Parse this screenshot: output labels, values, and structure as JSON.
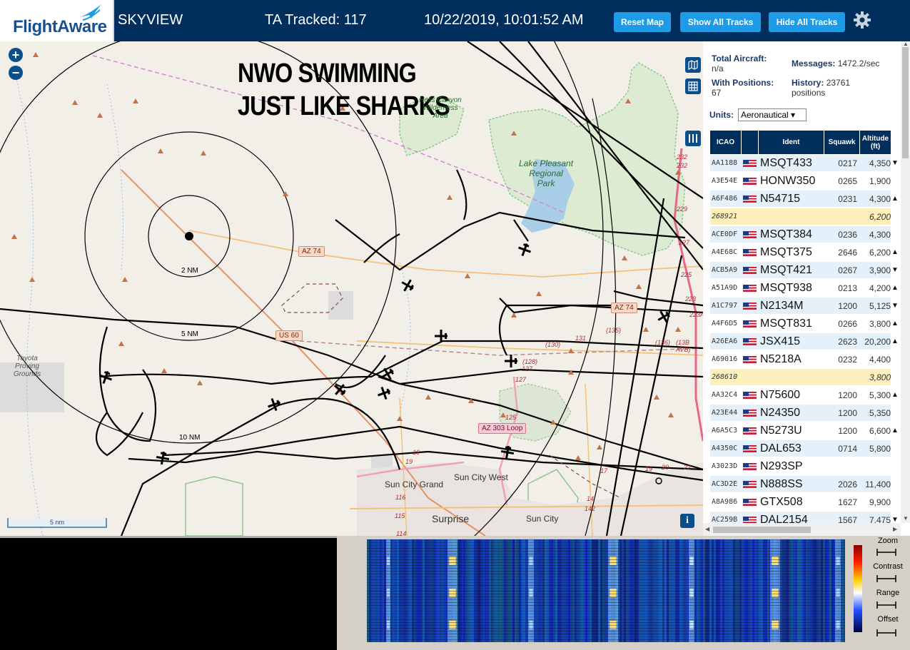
{
  "header": {
    "logo_text": "FlightAware",
    "app_name": "SKYVIEW",
    "tracked": "TA Tracked: 117",
    "datetime": "10/22/2019, 10:01:52 AM",
    "buttons": {
      "reset_map": "Reset Map",
      "show_all": "Show All Tracks",
      "hide_all": "Hide All Tracks"
    },
    "colors": {
      "bar": "#002f5d",
      "button": "#1e9be6"
    }
  },
  "map": {
    "zoom_in": "+",
    "zoom_out": "−",
    "overlay_line1": "NWO SWIMMING",
    "overlay_line2": "JUST LIKE SHARKS",
    "rings": {
      "r2": "2 NM",
      "r5": "5 NM",
      "r10": "10 NM"
    },
    "places": {
      "hells_canyon": "Hells Canyon\nWilderness\nArea",
      "lake_pleasant": "Lake Pleasant\nRegional\nPark",
      "toyota": "Toyota\nProving\nGrounds",
      "sun_city_grand": "Sun City Grand",
      "sun_city_west": "Sun City West",
      "surprise": "Surprise",
      "sun_city": "Sun City"
    },
    "shields": {
      "az74a": "AZ 74",
      "az74b": "AZ 74",
      "us60": "US 60",
      "loop303": "AZ 303 Loop"
    },
    "route_numbers": [
      "232",
      "232",
      "229",
      "227",
      "225",
      "223",
      "223A",
      "(136)",
      "(13B AVB)",
      "(135)",
      "131",
      "(130)",
      "(128)",
      "127",
      "127",
      "125",
      "19",
      "19",
      "20",
      "22",
      "19",
      "17",
      "116",
      "115",
      "114",
      "142",
      "14"
    ],
    "scale": "5 nm",
    "info": "i"
  },
  "panel": {
    "total_aircraft_label": "Total Aircraft:",
    "total_aircraft_value": "n/a",
    "messages_label": "Messages:",
    "messages_value": "1472.2/sec",
    "positions_label": "With Positions:",
    "positions_value": "67",
    "history_label": "History:",
    "history_value": "23761",
    "history_unit": "positions",
    "units_label": "Units:",
    "units_value": "Aeronautical ▾",
    "columns": {
      "icao": "ICAO",
      "ident": "Ident",
      "squawk": "Squawk",
      "altitude": "Altitude",
      "altitude_unit": "(ft)"
    },
    "rows": [
      {
        "icao": "AA1188",
        "ident": "MSQT433",
        "squawk": "0217",
        "alt": "4,350",
        "trend": "▼",
        "hl": false,
        "flag": true
      },
      {
        "icao": "A3E54E",
        "ident": "HONW350",
        "squawk": "0265",
        "alt": "1,900",
        "trend": "",
        "hl": false,
        "flag": true
      },
      {
        "icao": "A6F486",
        "ident": "N54715",
        "squawk": "0231",
        "alt": "4,300",
        "trend": "▲",
        "hl": false,
        "flag": true
      },
      {
        "icao": "268921",
        "ident": "",
        "squawk": "",
        "alt": "6,200",
        "trend": "",
        "hl": true,
        "flag": false
      },
      {
        "icao": "ACE0DF",
        "ident": "MSQT384",
        "squawk": "0236",
        "alt": "4,300",
        "trend": "",
        "hl": false,
        "flag": true
      },
      {
        "icao": "A4E68C",
        "ident": "MSQT375",
        "squawk": "2646",
        "alt": "6,200",
        "trend": "▲",
        "hl": false,
        "flag": true
      },
      {
        "icao": "ACB5A9",
        "ident": "MSQT421",
        "squawk": "0267",
        "alt": "3,900",
        "trend": "▼",
        "hl": false,
        "flag": true
      },
      {
        "icao": "A51A9D",
        "ident": "MSQT938",
        "squawk": "0213",
        "alt": "4,200",
        "trend": "▲",
        "hl": false,
        "flag": true
      },
      {
        "icao": "A1C797",
        "ident": "N2134M",
        "squawk": "1200",
        "alt": "5,125",
        "trend": "▼",
        "hl": false,
        "flag": true
      },
      {
        "icao": "A4F6D5",
        "ident": "MSQT831",
        "squawk": "0266",
        "alt": "3,800",
        "trend": "▲",
        "hl": false,
        "flag": true
      },
      {
        "icao": "A26EA6",
        "ident": "JSX415",
        "squawk": "2623",
        "alt": "20,200",
        "trend": "▲",
        "hl": false,
        "flag": true
      },
      {
        "icao": "A69016",
        "ident": "N5218A",
        "squawk": "0232",
        "alt": "4,400",
        "trend": "",
        "hl": false,
        "flag": true
      },
      {
        "icao": "268610",
        "ident": "",
        "squawk": "",
        "alt": "3,800",
        "trend": "",
        "hl": true,
        "flag": false
      },
      {
        "icao": "AA32C4",
        "ident": "N75600",
        "squawk": "1200",
        "alt": "5,300",
        "trend": "▲",
        "hl": false,
        "flag": true
      },
      {
        "icao": "A23E44",
        "ident": "N24350",
        "squawk": "1200",
        "alt": "5,350",
        "trend": "",
        "hl": false,
        "flag": true
      },
      {
        "icao": "A6A5C3",
        "ident": "N5273U",
        "squawk": "1200",
        "alt": "6,600",
        "trend": "▲",
        "hl": false,
        "flag": true
      },
      {
        "icao": "A4350C",
        "ident": "DAL653",
        "squawk": "0714",
        "alt": "5,800",
        "trend": "",
        "hl": false,
        "flag": true
      },
      {
        "icao": "A3023D",
        "ident": "N293SP",
        "squawk": "",
        "alt": "",
        "trend": "",
        "hl": false,
        "flag": true
      },
      {
        "icao": "AC3D2E",
        "ident": "N888SS",
        "squawk": "2026",
        "alt": "11,400",
        "trend": "",
        "hl": false,
        "flag": true
      },
      {
        "icao": "A8A986",
        "ident": "GTX508",
        "squawk": "1627",
        "alt": "9,900",
        "trend": "",
        "hl": false,
        "flag": true
      },
      {
        "icao": "AC259B",
        "ident": "DAL2154",
        "squawk": "1567",
        "alt": "7,475",
        "trend": "▼",
        "hl": false,
        "flag": true
      }
    ]
  },
  "waterfall": {
    "zoom": "Zoom",
    "contrast": "Contrast",
    "range": "Range",
    "offset": "Offset"
  }
}
